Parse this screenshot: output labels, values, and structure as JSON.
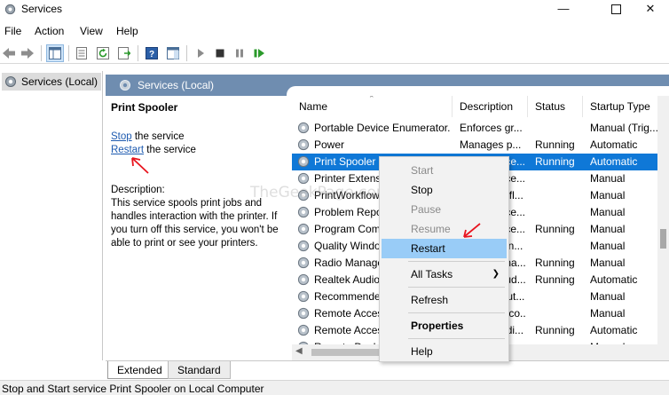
{
  "window": {
    "title": "Services",
    "icons": {
      "app": "gear-icon",
      "minimize": "minimize-icon",
      "maximize": "maximize-icon",
      "close": "close-icon"
    }
  },
  "menu": [
    "File",
    "Action",
    "View",
    "Help"
  ],
  "toolbar": [
    "back-icon",
    "forward-icon",
    "console-tree-icon",
    "properties-icon",
    "refresh-icon",
    "export-list-icon",
    "help-icon",
    "show-hide-icon",
    "start-service-icon",
    "stop-service-icon",
    "pause-service-icon",
    "resume-service-icon"
  ],
  "tree": {
    "root": "Services (Local)"
  },
  "pane": {
    "header": "Services (Local)"
  },
  "extended": {
    "service_name": "Print Spooler",
    "stop_link": "Stop",
    "stop_suffix": " the service",
    "restart_link": "Restart",
    "restart_suffix": " the service",
    "description_label": "Description:",
    "description": "This service spools print jobs and handles interaction with the printer. If you turn off this service, you won't be able to print or see your printers."
  },
  "columns": {
    "name": "Name",
    "description": "Description",
    "status": "Status",
    "startup": "Startup Type"
  },
  "rows": [
    {
      "name": "Portable Device Enumerator...",
      "description": "Enforces gr...",
      "status": "",
      "startup": "Manual (Trig..."
    },
    {
      "name": "Power",
      "description": "Manages p...",
      "status": "Running",
      "startup": "Automatic"
    },
    {
      "name": "Print Spooler",
      "description": "This service...",
      "status": "Running",
      "startup": "Automatic",
      "selected": true
    },
    {
      "name": "Printer Extensions and Notifi...",
      "description": "This service...",
      "status": "",
      "startup": "Manual"
    },
    {
      "name": "PrintWorkflow_...",
      "description": "Print Workfl...",
      "status": "",
      "startup": "Manual"
    },
    {
      "name": "Problem Reports Control Pa...",
      "description": "This service...",
      "status": "",
      "startup": "Manual"
    },
    {
      "name": "Program Compatibility Assi...",
      "description": "This service...",
      "status": "Running",
      "startup": "Manual"
    },
    {
      "name": "Quality Windows Audio Vid...",
      "description": "Quality Win...",
      "status": "",
      "startup": "Manual"
    },
    {
      "name": "Radio Management Service",
      "description": "Radio Mana...",
      "status": "Running",
      "startup": "Manual"
    },
    {
      "name": "Realtek Audio Universal Serv...",
      "description": "Realtek Aud...",
      "status": "Running",
      "startup": "Automatic"
    },
    {
      "name": "Recommended Troubleshoot...",
      "description": "Enables aut...",
      "status": "",
      "startup": "Manual"
    },
    {
      "name": "Remote Access Auto Conne...",
      "description": "Creates a co...",
      "status": "",
      "startup": "Manual"
    },
    {
      "name": "Remote Access Connection...",
      "description": "Manages di...",
      "status": "Running",
      "startup": "Automatic"
    },
    {
      "name": "Remote Desktop Configurat...",
      "description": "Remote Des...",
      "status": "",
      "startup": "Manual"
    }
  ],
  "context_menu": [
    {
      "label": "Start",
      "disabled": true
    },
    {
      "label": "Stop"
    },
    {
      "label": "Pause",
      "disabled": true
    },
    {
      "label": "Resume",
      "disabled": true
    },
    {
      "label": "Restart",
      "hover": true
    },
    {
      "sep": true
    },
    {
      "label": "All Tasks",
      "submenu": true
    },
    {
      "sep": true
    },
    {
      "label": "Refresh"
    },
    {
      "sep": true
    },
    {
      "label": "Properties",
      "bold": true
    },
    {
      "sep": true
    },
    {
      "label": "Help"
    }
  ],
  "tabs": [
    {
      "label": "Extended",
      "active": true
    },
    {
      "label": "Standard",
      "active": false
    }
  ],
  "status_bar": "Stop and Start service Print Spooler on Local Computer",
  "watermark": "TheGeekPage.com",
  "colors": {
    "header_blue": "#6f8db0",
    "selection": "#0f78d7",
    "menu_hover": "#99ccf7",
    "link": "#1e5bb0",
    "annotation": "#e8141e"
  }
}
